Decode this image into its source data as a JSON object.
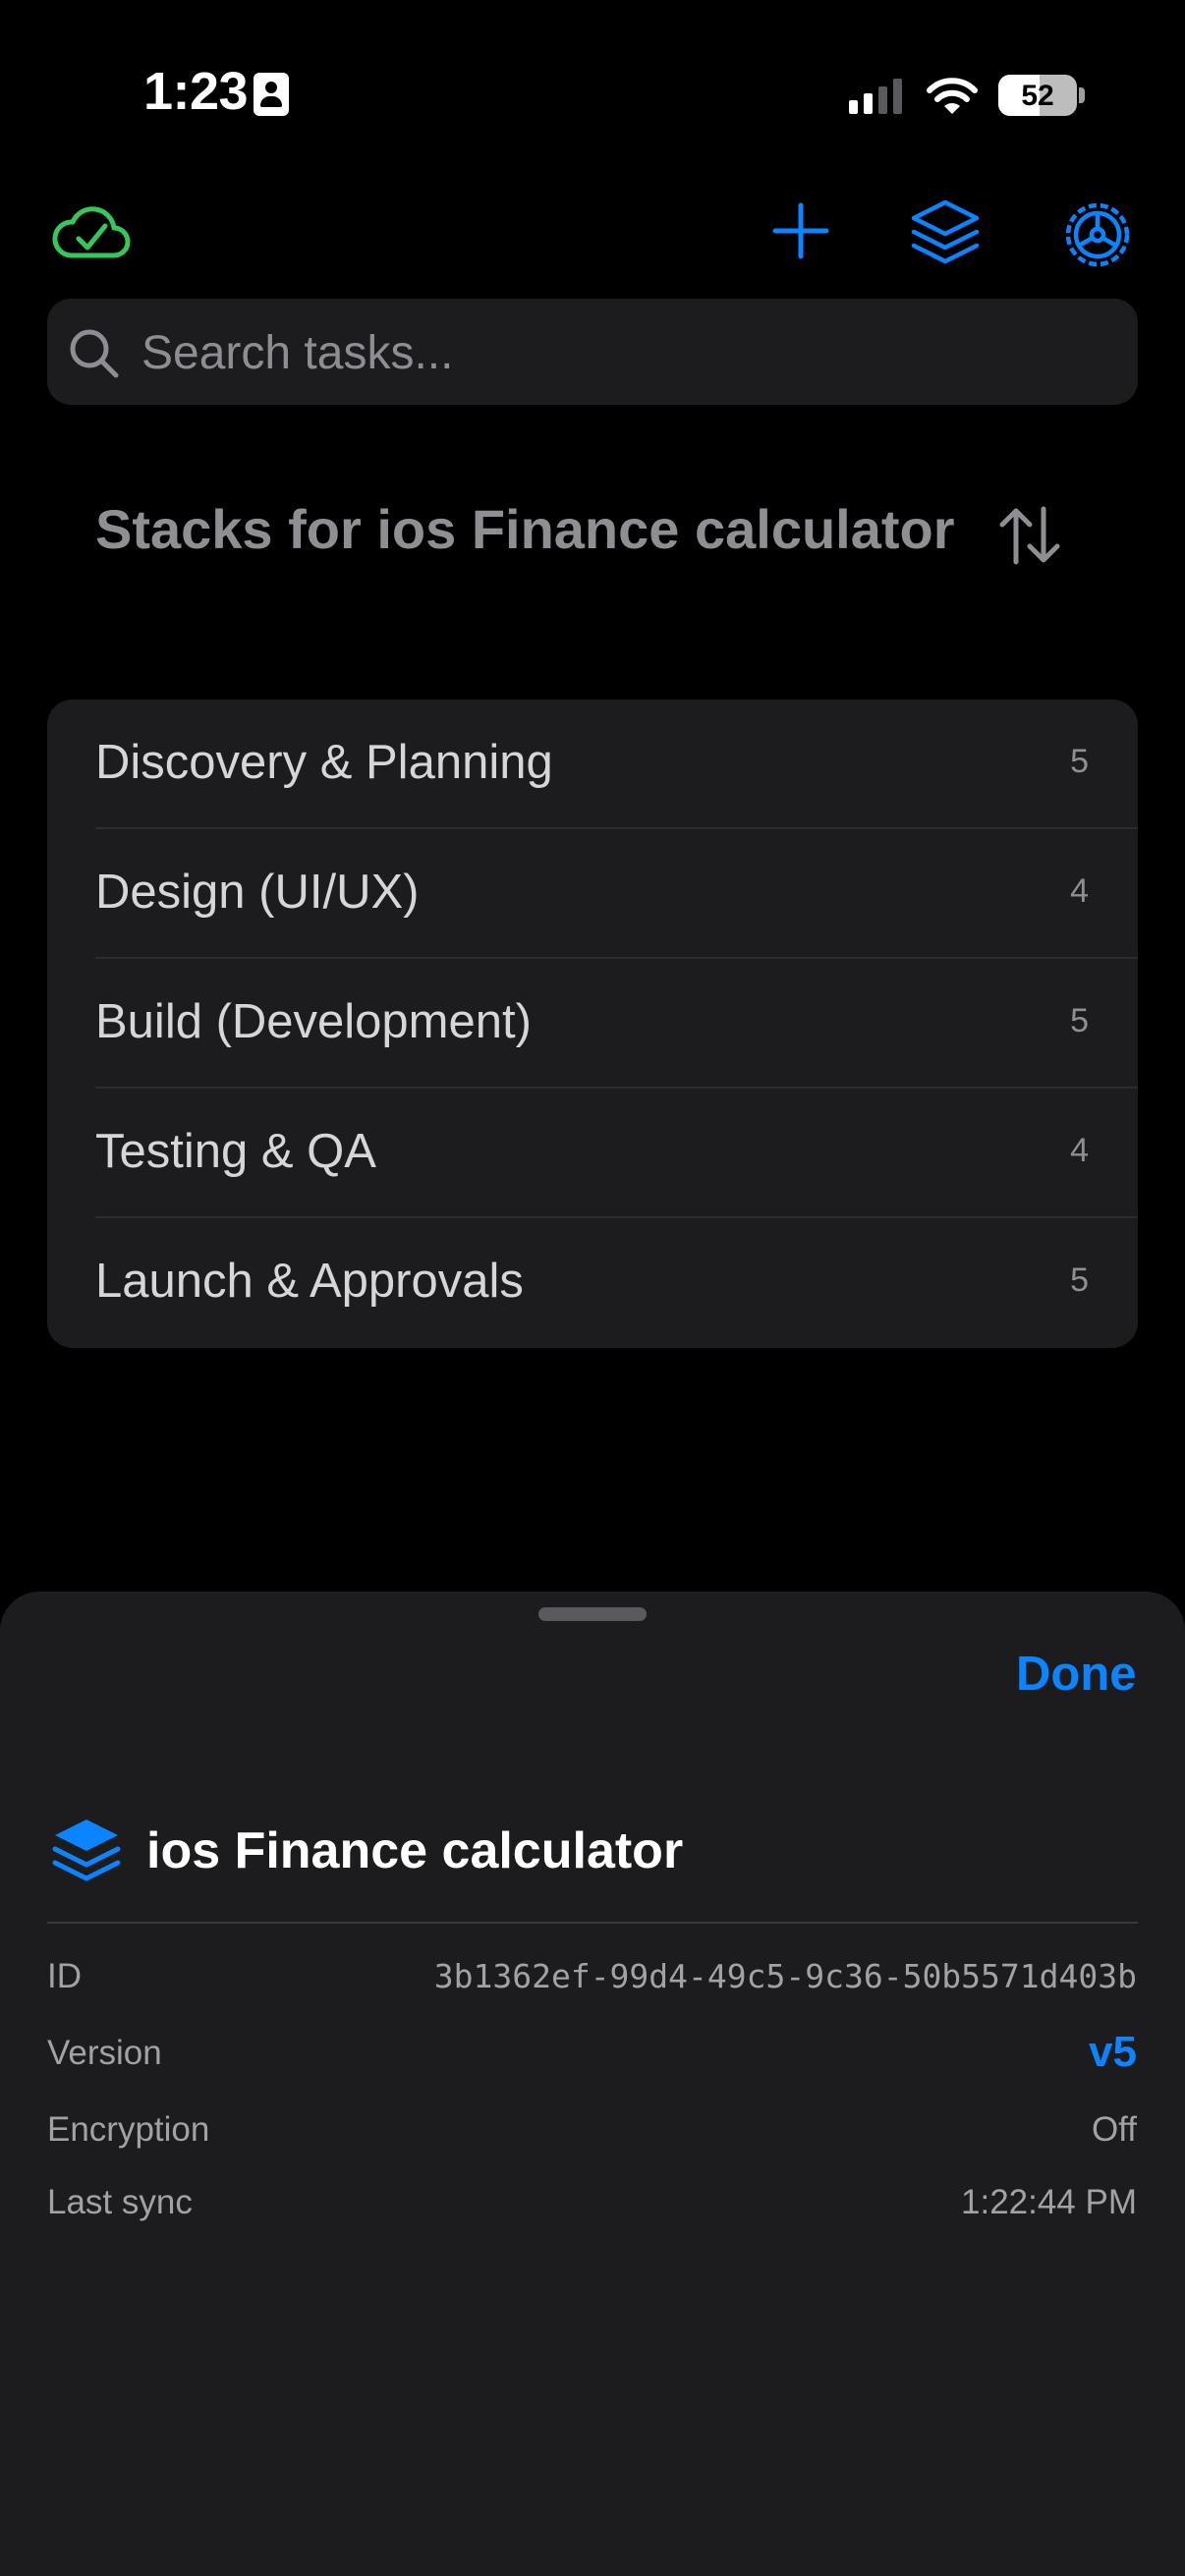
{
  "status_bar": {
    "time": "1:23",
    "battery": "52"
  },
  "search": {
    "placeholder": "Search tasks..."
  },
  "header": {
    "title": "Stacks for ios Finance calculator"
  },
  "stacks": [
    {
      "label": "Discovery & Planning",
      "count": "5"
    },
    {
      "label": "Design (UI/UX)",
      "count": "4"
    },
    {
      "label": "Build (Development)",
      "count": "5"
    },
    {
      "label": "Testing & QA",
      "count": "4"
    },
    {
      "label": "Launch & Approvals",
      "count": "5"
    }
  ],
  "sheet": {
    "done_label": "Done",
    "project_name": "ios Finance calculator",
    "info": {
      "id_label": "ID",
      "id_value": "3b1362ef-99d4-49c5-9c36-50b5571d403b",
      "version_label": "Version",
      "version_value": "v5",
      "encryption_label": "Encryption",
      "encryption_value": "Off",
      "last_sync_label": "Last sync",
      "last_sync_value": "1:22:44 PM"
    }
  },
  "colors": {
    "accent": "#0a84ff",
    "sync_ok": "#34c759",
    "background": "#000000",
    "surface": "#1c1c1e"
  },
  "icons": [
    "contact-card-icon",
    "cellular-signal-icon",
    "wifi-icon",
    "battery-icon",
    "cloud-check-icon",
    "plus-icon",
    "stack-layers-icon",
    "gear-icon",
    "search-icon",
    "sort-arrows-icon"
  ]
}
